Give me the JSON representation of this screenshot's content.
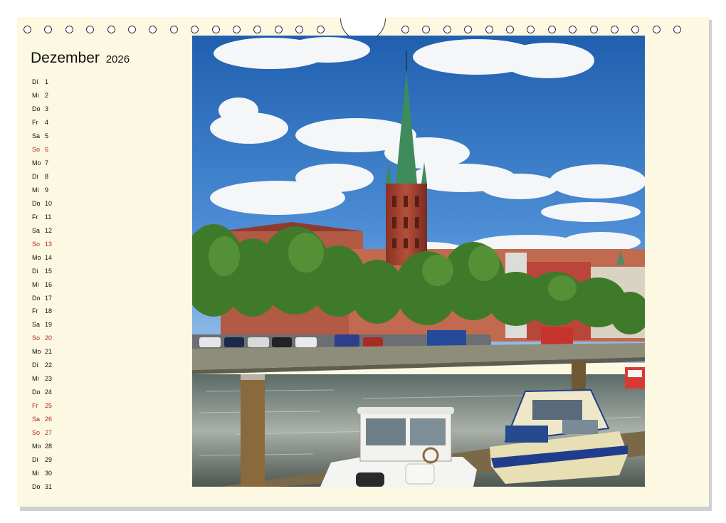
{
  "calendar": {
    "month": "Dezember",
    "year": "2026",
    "days": [
      {
        "wd": "Di",
        "num": "1",
        "red": false
      },
      {
        "wd": "Mi",
        "num": "2",
        "red": false
      },
      {
        "wd": "Do",
        "num": "3",
        "red": false
      },
      {
        "wd": "Fr",
        "num": "4",
        "red": false
      },
      {
        "wd": "Sa",
        "num": "5",
        "red": false
      },
      {
        "wd": "So",
        "num": "6",
        "red": true
      },
      {
        "wd": "Mo",
        "num": "7",
        "red": false
      },
      {
        "wd": "Di",
        "num": "8",
        "red": false
      },
      {
        "wd": "Mi",
        "num": "9",
        "red": false
      },
      {
        "wd": "Do",
        "num": "10",
        "red": false
      },
      {
        "wd": "Fr",
        "num": "11",
        "red": false
      },
      {
        "wd": "Sa",
        "num": "12",
        "red": false
      },
      {
        "wd": "So",
        "num": "13",
        "red": true
      },
      {
        "wd": "Mo",
        "num": "14",
        "red": false
      },
      {
        "wd": "Di",
        "num": "15",
        "red": false
      },
      {
        "wd": "Mi",
        "num": "16",
        "red": false
      },
      {
        "wd": "Do",
        "num": "17",
        "red": false
      },
      {
        "wd": "Fr",
        "num": "18",
        "red": false
      },
      {
        "wd": "Sa",
        "num": "19",
        "red": false
      },
      {
        "wd": "So",
        "num": "20",
        "red": true
      },
      {
        "wd": "Mo",
        "num": "21",
        "red": false
      },
      {
        "wd": "Di",
        "num": "22",
        "red": false
      },
      {
        "wd": "Mi",
        "num": "23",
        "red": false
      },
      {
        "wd": "Do",
        "num": "24",
        "red": false
      },
      {
        "wd": "Fr",
        "num": "25",
        "red": true
      },
      {
        "wd": "Sa",
        "num": "26",
        "red": true
      },
      {
        "wd": "So",
        "num": "27",
        "red": true
      },
      {
        "wd": "Mo",
        "num": "28",
        "red": false
      },
      {
        "wd": "Di",
        "num": "29",
        "red": false
      },
      {
        "wd": "Mi",
        "num": "30",
        "red": false
      },
      {
        "wd": "Do",
        "num": "31",
        "red": false
      }
    ]
  },
  "colors": {
    "page": "#fcf8e1",
    "holiday": "#b3262a",
    "text": "#111111"
  },
  "photo": {
    "subject": "city-river-scene-with-church-spire-and-boats"
  }
}
